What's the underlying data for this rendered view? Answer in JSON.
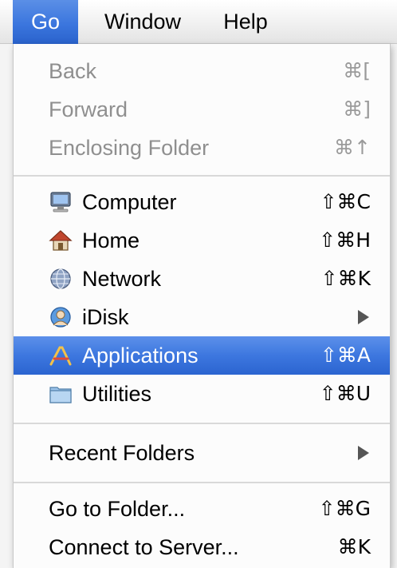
{
  "menubar": {
    "items": [
      "Go",
      "Window",
      "Help"
    ],
    "active": "Go"
  },
  "menu": {
    "back": {
      "label": "Back",
      "shortcut": "⌘["
    },
    "forward": {
      "label": "Forward",
      "shortcut": "⌘]"
    },
    "enclosing": {
      "label": "Enclosing Folder",
      "shortcut": "⌘↑"
    },
    "computer": {
      "label": "Computer",
      "shortcut": "⇧⌘C",
      "icon": "computer-icon"
    },
    "home": {
      "label": "Home",
      "shortcut": "⇧⌘H",
      "icon": "home-icon"
    },
    "network": {
      "label": "Network",
      "shortcut": "⇧⌘K",
      "icon": "network-icon"
    },
    "idisk": {
      "label": "iDisk",
      "icon": "idisk-icon"
    },
    "applications": {
      "label": "Applications",
      "shortcut": "⇧⌘A",
      "icon": "applications-icon"
    },
    "utilities": {
      "label": "Utilities",
      "shortcut": "⇧⌘U",
      "icon": "utilities-folder-icon"
    },
    "recent": {
      "label": "Recent Folders"
    },
    "goto": {
      "label": "Go to Folder...",
      "shortcut": "⇧⌘G"
    },
    "connect": {
      "label": "Connect to Server...",
      "shortcut": "⌘K"
    }
  },
  "colors": {
    "highlight": "#3b76de",
    "disabled_text": "#8f8f8f"
  }
}
